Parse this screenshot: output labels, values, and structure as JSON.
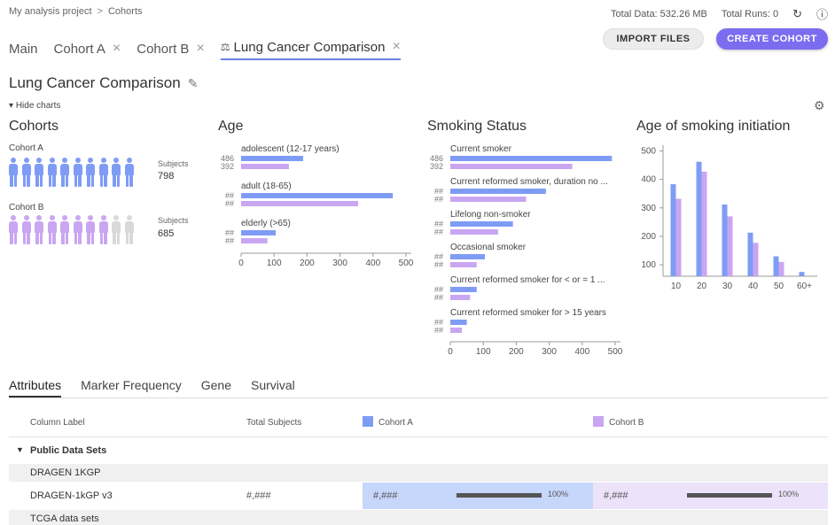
{
  "breadcrumb": {
    "project": "My analysis project",
    "separator": ">",
    "current": "Cohorts"
  },
  "stats": {
    "total_data": "Total Data: 532.26 MB",
    "total_runs": "Total Runs: 0",
    "refresh_icon": "refresh-icon",
    "help_icon": "help-icon"
  },
  "tabs": [
    {
      "label": "Main",
      "closable": false
    },
    {
      "label": "Cohort A",
      "closable": true
    },
    {
      "label": "Cohort B",
      "closable": true
    },
    {
      "label": "Lung Cancer Comparison",
      "closable": true,
      "active": true,
      "icon": "scale-icon"
    }
  ],
  "buttons": {
    "import": "IMPORT FILES",
    "create": "CREATE COHORT"
  },
  "page": {
    "title": "Lung Cancer Comparison",
    "hide_charts": "Hide charts"
  },
  "colors": {
    "cohort_a": "#7f9cf5",
    "cohort_b": "#c9a6f2",
    "inactive_person": "#d9d9d9",
    "accent": "#7b6cf0"
  },
  "cohorts_panel": {
    "title": "Cohorts",
    "cohorts": [
      {
        "name": "Cohort A",
        "subjects_label": "Subjects",
        "subjects": "798",
        "filled": 10,
        "total": 10
      },
      {
        "name": "Cohort B",
        "subjects_label": "Subjects",
        "subjects": "685",
        "filled": 8,
        "total": 10
      }
    ]
  },
  "chart_data": [
    {
      "type": "bar",
      "title": "Age",
      "orientation": "horizontal",
      "categories": [
        "adolescent (12-17 years)",
        "adult (18-65)",
        "elderly (>65)"
      ],
      "value_labels": [
        [
          "486",
          "392"
        ],
        [
          "##",
          "##"
        ],
        [
          "##",
          "##"
        ]
      ],
      "series": [
        {
          "name": "Cohort A",
          "values": [
            188,
            460,
            105
          ]
        },
        {
          "name": "Cohort B",
          "values": [
            145,
            355,
            80
          ]
        }
      ],
      "xticks": [
        "0",
        "100",
        "200",
        "300",
        "400",
        "500"
      ],
      "xlim": [
        0,
        500
      ]
    },
    {
      "type": "bar",
      "title": "Smoking Status",
      "orientation": "horizontal",
      "categories": [
        "Current smoker",
        "Current reformed smoker, duration no ...",
        "Lifelong non-smoker",
        "Occasional smoker",
        "Current reformed smoker for < or = 1 ...",
        "Current reformed smoker for > 15 years"
      ],
      "value_labels": [
        [
          "486",
          "392"
        ],
        [
          "##",
          "##"
        ],
        [
          "##",
          "##"
        ],
        [
          "##",
          "##"
        ],
        [
          "##",
          "##"
        ],
        [
          "##",
          "##"
        ]
      ],
      "series": [
        {
          "name": "Cohort A",
          "values": [
            490,
            290,
            190,
            105,
            80,
            50
          ]
        },
        {
          "name": "Cohort B",
          "values": [
            370,
            230,
            145,
            80,
            60,
            35
          ]
        }
      ],
      "xticks": [
        "0",
        "100",
        "200",
        "300",
        "400",
        "500"
      ],
      "xlim": [
        0,
        500
      ]
    },
    {
      "type": "bar",
      "title": "Age of smoking initiation",
      "orientation": "vertical",
      "categories": [
        "10",
        "20",
        "30",
        "40",
        "50",
        "60+"
      ],
      "series": [
        {
          "name": "Cohort A",
          "values": [
            383,
            462,
            312,
            213,
            130,
            75
          ]
        },
        {
          "name": "Cohort B",
          "values": [
            332,
            427,
            270,
            177,
            110,
            60
          ]
        }
      ],
      "yticks": [
        "100",
        "200",
        "300",
        "400",
        "500"
      ],
      "ylim": [
        60,
        520
      ]
    }
  ],
  "bottom_tabs": [
    {
      "label": "Attributes",
      "active": true
    },
    {
      "label": "Marker Frequency"
    },
    {
      "label": "Gene"
    },
    {
      "label": "Survival"
    }
  ],
  "table": {
    "headers": {
      "column_label": "Column Label",
      "total_subjects": "Total Subjects",
      "cohort_a": "Cohort A",
      "cohort_b": "Cohort B"
    },
    "group": "Public Data Sets",
    "subgroup_1": "DRAGEN 1KGP",
    "row": {
      "label": "DRAGEN-1kGP v3",
      "total": "#,###",
      "a_value": "#,###",
      "a_pct": "100%",
      "a_fraction": 1.0,
      "b_value": "#,###",
      "b_pct": "100%",
      "b_fraction": 1.0
    },
    "subgroup_2": "TCGA data sets"
  }
}
